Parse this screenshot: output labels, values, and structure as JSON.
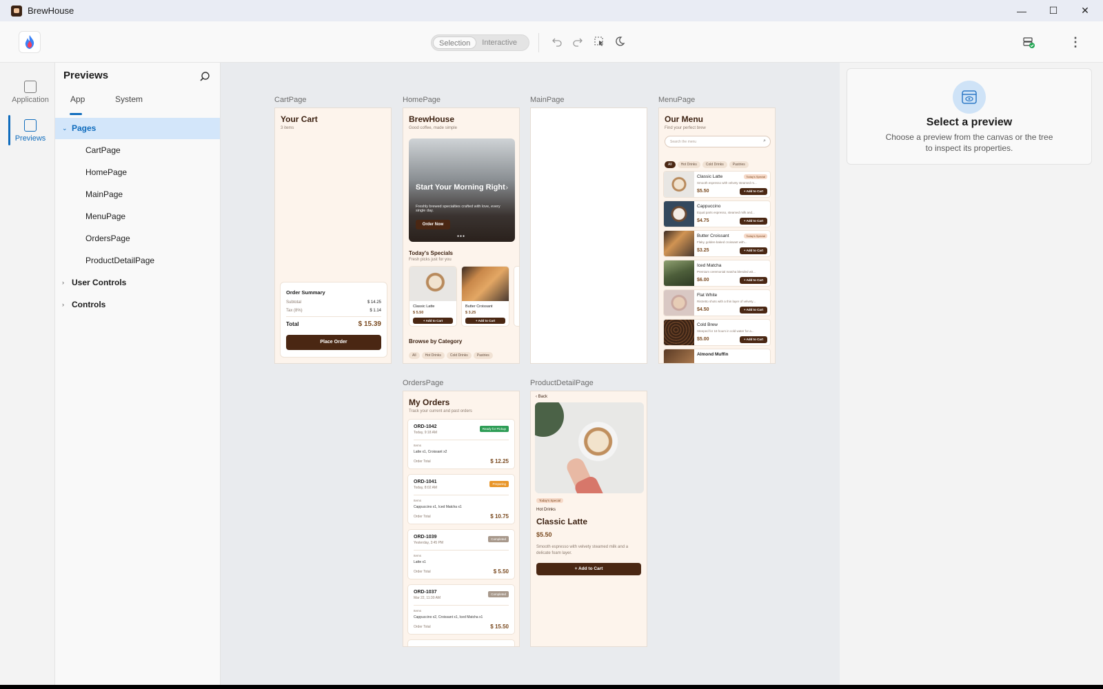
{
  "window": {
    "title": "BrewHouse",
    "controls": {
      "minimize": "—",
      "maximize": "☐",
      "close": "✕"
    }
  },
  "toolbar": {
    "mode_selection": "Selection",
    "mode_interactive": "Interactive"
  },
  "rail": {
    "application": "Application",
    "previews": "Previews"
  },
  "tree": {
    "title": "Previews",
    "tabs": [
      "App",
      "System"
    ],
    "pages_label": "Pages",
    "pages": [
      "CartPage",
      "HomePage",
      "MainPage",
      "MenuPage",
      "OrdersPage",
      "ProductDetailPage"
    ],
    "user_controls": "User Controls",
    "controls": "Controls"
  },
  "inspector": {
    "title": "Select a preview",
    "body": "Choose a preview from the canvas or the tree to inspect its properties."
  },
  "canvas": {
    "labels": {
      "cart": "CartPage",
      "home": "HomePage",
      "main": "MainPage",
      "menu": "MenuPage",
      "orders": "OrdersPage",
      "detail": "ProductDetailPage"
    }
  },
  "cart": {
    "title": "Your Cart",
    "count": "3 items",
    "summary_title": "Order Summary",
    "subtotal_label": "Subtotal",
    "subtotal": "$ 14.25",
    "tax_label": "Tax (8%)",
    "tax": "$ 1.14",
    "total_label": "Total",
    "total": "$ 15.39",
    "place_order": "Place Order"
  },
  "home": {
    "title": "BrewHouse",
    "subtitle": "Good coffee, made simple",
    "hero_title": "Start Your Morning Right",
    "hero_text": "Freshly brewed specialties crafted with love, every single day.",
    "hero_button": "Order Now",
    "specials_title": "Today's Specials",
    "specials_sub": "Fresh picks just for you",
    "specials": [
      {
        "name": "Classic Latte",
        "price": "$ 5.50",
        "button": "+ Add to Cart"
      },
      {
        "name": "Butter Croissant",
        "price": "$ 3.25",
        "button": "+ Add to Cart"
      }
    ],
    "browse_title": "Browse by Category",
    "categories": [
      "All",
      "Hot Drinks",
      "Cold Drinks",
      "Pastries"
    ]
  },
  "menu": {
    "title": "Our Menu",
    "subtitle": "Find your perfect brew",
    "search_placeholder": "Search the menu",
    "chips": [
      "All",
      "Hot Drinks",
      "Cold Drinks",
      "Pastries"
    ],
    "items": [
      {
        "name": "Classic Latte",
        "desc": "Smooth espresso with velvety steamed m...",
        "price": "$5.50",
        "tag": "Today's Special",
        "button": "+ Add to Cart"
      },
      {
        "name": "Cappuccino",
        "desc": "Equal parts espresso, steamed milk and...",
        "price": "$4.75",
        "tag": "",
        "button": "+ Add to Cart"
      },
      {
        "name": "Butter Croissant",
        "desc": "Flaky, golden-baked croissant with...",
        "price": "$3.25",
        "tag": "Today's Special",
        "button": "+ Add to Cart"
      },
      {
        "name": "Iced Matcha",
        "desc": "Premium ceremonial matcha blended wit...",
        "price": "$6.00",
        "tag": "",
        "button": "+ Add to Cart"
      },
      {
        "name": "Flat White",
        "desc": "Ristretto shots with a thin layer of velvety...",
        "price": "$4.50",
        "tag": "",
        "button": "+ Add to Cart"
      },
      {
        "name": "Cold Brew",
        "desc": "Steeped for 18 hours in cold water for a...",
        "price": "$5.00",
        "tag": "",
        "button": "+ Add to Cart"
      }
    ],
    "partial_item": "Almond Muffin"
  },
  "orders": {
    "title": "My Orders",
    "subtitle": "Track your current and past orders",
    "items_label": "Items",
    "total_label": "Order Total",
    "list": [
      {
        "id": "ORD-1042",
        "time": "Today, 9:18 AM",
        "status": "Ready for Pickup",
        "status_color": "#2e9d56",
        "items": "Latte x1, Croissant x2",
        "total": "$ 12.25"
      },
      {
        "id": "ORD-1041",
        "time": "Today, 8:02 AM",
        "status": "Preparing",
        "status_color": "#e8962a",
        "items": "Cappuccino x1, Iced Matcha x1",
        "total": "$ 10.75"
      },
      {
        "id": "ORD-1039",
        "time": "Yesterday, 3:45 PM",
        "status": "Completed",
        "status_color": "#a8998c",
        "items": "Latte x1",
        "total": "$ 5.50"
      },
      {
        "id": "ORD-1037",
        "time": "Mar 22, 11:30 AM",
        "status": "Completed",
        "status_color": "#a8998c",
        "items": "Cappuccino x2, Croissant x1, Iced Matcha x1",
        "total": "$ 15.50"
      }
    ]
  },
  "detail": {
    "back": "Back",
    "tag": "Today's Special",
    "category": "Hot Drinks",
    "name": "Classic Latte",
    "price": "$5.50",
    "desc": "Smooth espresso with velvety steamed milk and a delicate foam layer.",
    "button": "+ Add to Cart"
  },
  "colors": {
    "accent": "#0f6cbd",
    "brand_dark": "#4a2713",
    "page_bg": "#fdf4ec",
    "price": "#7a4a20"
  }
}
